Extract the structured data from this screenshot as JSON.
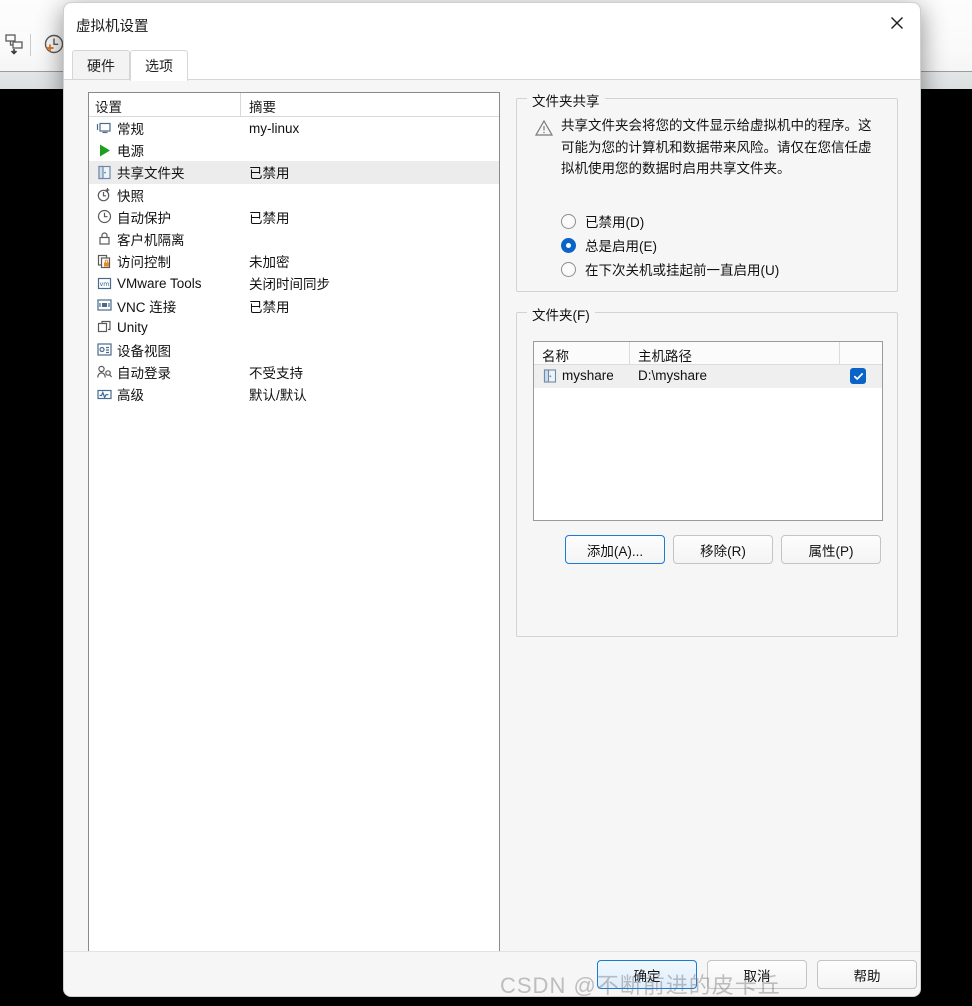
{
  "background": {
    "toolbar_icons": [
      {
        "name": "manage-snapshots-icon"
      },
      {
        "name": "take-snapshot-icon"
      }
    ]
  },
  "dialog": {
    "title": "虚拟机设置",
    "close_label": "✕",
    "tabs": [
      {
        "label": "硬件",
        "active": false
      },
      {
        "label": "选项",
        "active": true
      }
    ]
  },
  "settings_list": {
    "headers": {
      "settings": "设置",
      "summary": "摘要"
    },
    "rows": [
      {
        "icon": "monitor-icon",
        "label": "常规",
        "summary": "my-linux",
        "selected": false
      },
      {
        "icon": "power-icon",
        "label": "电源",
        "summary": "",
        "selected": false
      },
      {
        "icon": "shared-folder-icon",
        "label": "共享文件夹",
        "summary": "已禁用",
        "selected": true
      },
      {
        "icon": "snapshot-icon",
        "label": "快照",
        "summary": "",
        "selected": false
      },
      {
        "icon": "autoprotect-icon",
        "label": "自动保护",
        "summary": "已禁用",
        "selected": false
      },
      {
        "icon": "lock-icon",
        "label": "客户机隔离",
        "summary": "",
        "selected": false
      },
      {
        "icon": "access-control-icon",
        "label": "访问控制",
        "summary": "未加密",
        "selected": false
      },
      {
        "icon": "vmware-tools-icon",
        "label": "VMware Tools",
        "summary": "关闭时间同步",
        "selected": false
      },
      {
        "icon": "vnc-icon",
        "label": "VNC 连接",
        "summary": "已禁用",
        "selected": false
      },
      {
        "icon": "unity-icon",
        "label": "Unity",
        "summary": "",
        "selected": false
      },
      {
        "icon": "device-view-icon",
        "label": "设备视图",
        "summary": "",
        "selected": false
      },
      {
        "icon": "autologin-icon",
        "label": "自动登录",
        "summary": "不受支持",
        "selected": false
      },
      {
        "icon": "advanced-icon",
        "label": "高级",
        "summary": "默认/默认",
        "selected": false
      }
    ]
  },
  "sharing": {
    "group_title": "文件夹共享",
    "warning_icon": "warning-icon",
    "warning_text": "共享文件夹会将您的文件显示给虚拟机中的程序。这可能为您的计算机和数据带来风险。请仅在您信任虚拟机使用您的数据时启用共享文件夹。",
    "options": [
      {
        "label": "已禁用(D)",
        "checked": false
      },
      {
        "label": "总是启用(E)",
        "checked": true
      },
      {
        "label": "在下次关机或挂起前一直启用(U)",
        "checked": false
      }
    ]
  },
  "folders": {
    "group_title": "文件夹(F)",
    "columns": {
      "name": "名称",
      "path": "主机路径"
    },
    "rows": [
      {
        "icon": "shared-folder-icon",
        "name": "myshare",
        "path": "D:\\myshare",
        "enabled": true
      }
    ],
    "buttons": {
      "add": "添加(A)...",
      "remove": "移除(R)",
      "properties": "属性(P)"
    }
  },
  "footer": {
    "ok": "确定",
    "cancel": "取消",
    "help": "帮助"
  },
  "watermark": "CSDN @不断前进的皮卡丘",
  "colors": {
    "accent": "#0a64c8",
    "focus_border": "#1a7ad4",
    "selected_row": "#ececec"
  }
}
